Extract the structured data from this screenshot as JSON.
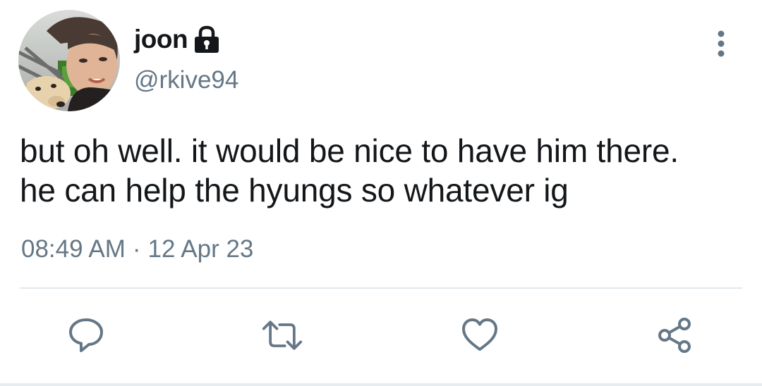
{
  "tweet": {
    "author": {
      "display_name": "joon",
      "handle": "@rkive94",
      "protected_icon": "lock-icon",
      "avatar": "profile-photo"
    },
    "text_lines": [
      "but oh well. it would be nice to have him there.",
      "he can help the hyungs so whatever ig"
    ],
    "time": "08:49 AM",
    "separator": "·",
    "date": "12 Apr 23",
    "more_icon": "more-vertical-icon",
    "actions": [
      {
        "icon": "reply-icon"
      },
      {
        "icon": "retweet-icon"
      },
      {
        "icon": "like-icon"
      },
      {
        "icon": "share-icon"
      }
    ]
  },
  "colors": {
    "text_primary": "#14171a",
    "text_secondary": "#657786",
    "divider": "#e1e8ed"
  }
}
